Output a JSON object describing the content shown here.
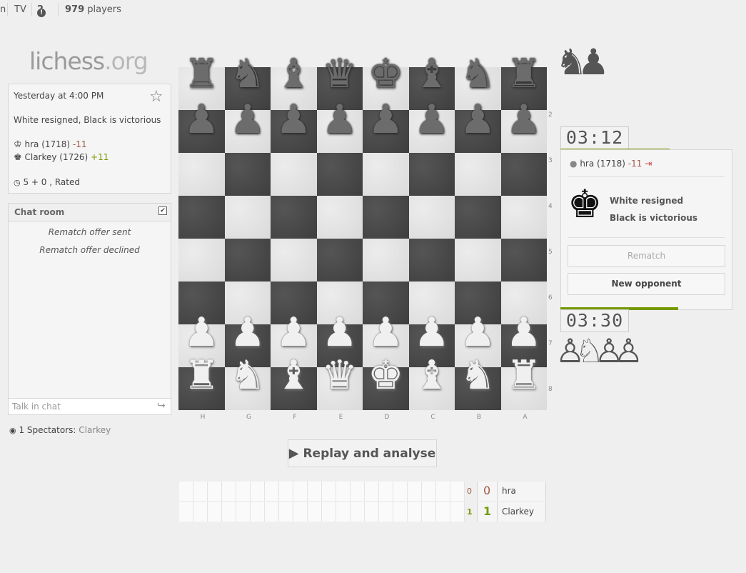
{
  "topbar": {
    "partial_item": "n",
    "tv": "TV",
    "alerts": "2",
    "player_count": "979",
    "players_label": "players"
  },
  "logo": {
    "name": "lichess",
    "tld": ".org"
  },
  "game_info": {
    "date": "Yesterday at 4:00 PM",
    "status": "White resigned, Black is victorious",
    "white": {
      "name": "hra (1718)",
      "diff": "-11"
    },
    "black": {
      "name": "Clarkey (1726)",
      "diff": "+11"
    },
    "mode": "5 + 0 , Rated"
  },
  "chat": {
    "title": "Chat room",
    "messages": [
      "Rematch offer sent",
      "Rematch offer declined"
    ],
    "placeholder": "Talk in chat"
  },
  "spectators": {
    "label": "1 Spectators:",
    "names": "Clarkey"
  },
  "board": {
    "files": [
      "H",
      "G",
      "F",
      "E",
      "D",
      "C",
      "B",
      "A"
    ],
    "ranks": [
      "2",
      "3",
      "4",
      "5",
      "6",
      "7",
      "8"
    ],
    "pieces": {
      "black_back": [
        "♜",
        "♞",
        "♝",
        "♛",
        "♚",
        "♝",
        "♞",
        "♜"
      ],
      "black_pawns": [
        "♟",
        "♟",
        "♟",
        "♟",
        "♟",
        "♟",
        "♟",
        "♟"
      ],
      "white_pawns": [
        "♟",
        "♟",
        "♟",
        "♟",
        "♟",
        "♟",
        "♟",
        "♟"
      ],
      "white_back": [
        "♜",
        "♞",
        "♝",
        "♛",
        "♚",
        "♝",
        "♞",
        "♜"
      ]
    }
  },
  "captured_top": [
    "♞",
    "♟"
  ],
  "captured_bottom": [
    "♙",
    "♘",
    "♙",
    "♙"
  ],
  "clock_top": "03:12",
  "clock_bottom": "03:30",
  "clock_top_fill": 0.65,
  "clock_bottom_fill": 0.7,
  "game_panel": {
    "player": "hra (1718)",
    "player_diff": "-11",
    "king_glyph": "♚",
    "result_line1": "White resigned",
    "result_line2": "Black is victorious",
    "rematch": "Rematch",
    "new_opponent": "New opponent"
  },
  "replay": {
    "icon": "▶",
    "label": "Replay and analyse"
  },
  "crosstable": {
    "rows": [
      {
        "small": "0",
        "total": "0",
        "name": "hra"
      },
      {
        "small": "1",
        "total": "1",
        "name": "Clarkey"
      }
    ]
  },
  "colors": {
    "green": "#759900",
    "red": "#a0574a",
    "exit": "#c44"
  }
}
